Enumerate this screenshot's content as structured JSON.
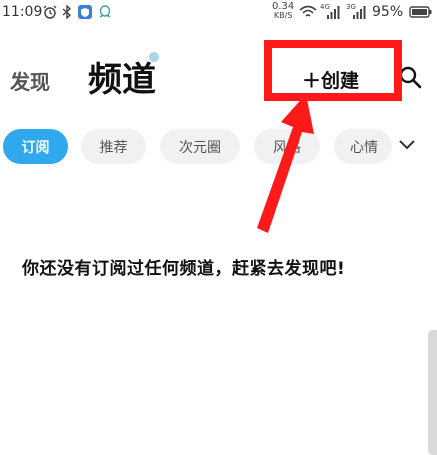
{
  "status_bar": {
    "time": "11:09",
    "net_speed_value": "0.34",
    "net_speed_unit": "KB/S",
    "signal1_label": "4G",
    "signal2_label": "3G",
    "battery": "95%"
  },
  "header": {
    "discover_tab": "发现",
    "channel_tab": "频道",
    "create_button": "＋创建"
  },
  "categories": [
    "订阅",
    "推荐",
    "次元圈",
    "风格",
    "心情"
  ],
  "empty_message": "你还没有订阅过任何频道，赶紧去发现吧!",
  "colors": {
    "accent": "#2fa8ee",
    "highlight": "#ff1a1a"
  }
}
